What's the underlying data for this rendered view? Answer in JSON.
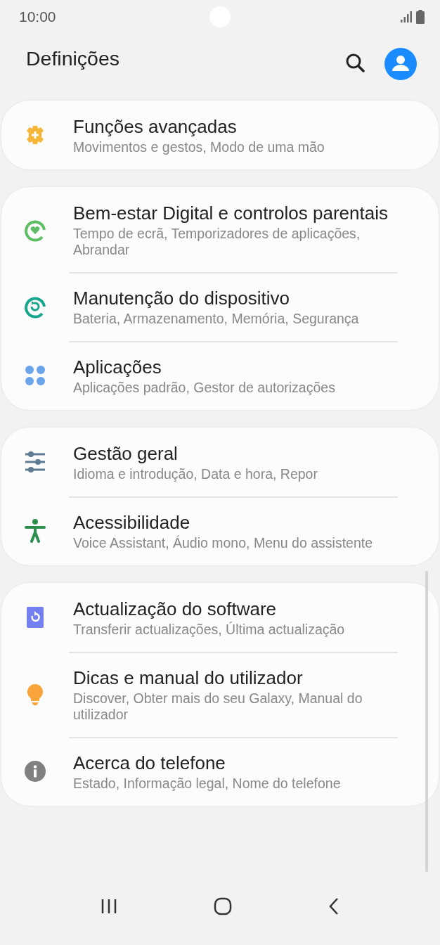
{
  "status_bar": {
    "time": "10:00"
  },
  "header": {
    "title": "Definições"
  },
  "groups": [
    {
      "items": [
        {
          "kind": "puzzle",
          "title": "Funções avançadas",
          "subtitle": "Movimentos e gestos, Modo de uma mão"
        }
      ]
    },
    {
      "items": [
        {
          "kind": "wellbeing",
          "title": "Bem-estar Digital e controlos parentais",
          "subtitle": "Tempo de ecrã, Temporizadores de aplicações, Abrandar"
        },
        {
          "kind": "care",
          "title": "Manutenção do dispositivo",
          "subtitle": "Bateria, Armazenamento, Memória, Segurança"
        },
        {
          "kind": "apps",
          "title": "Aplicações",
          "subtitle": "Aplicações padrão, Gestor de autorizações"
        }
      ]
    },
    {
      "items": [
        {
          "kind": "sliders",
          "title": "Gestão geral",
          "subtitle": "Idioma e introdução, Data e hora, Repor"
        },
        {
          "kind": "accessibility",
          "title": "Acessibilidade",
          "subtitle": "Voice Assistant, Áudio mono, Menu do assistente"
        }
      ]
    },
    {
      "items": [
        {
          "kind": "update",
          "title": "Actualização do software",
          "subtitle": "Transferir actualizações, Última actualização"
        },
        {
          "kind": "bulb",
          "title": "Dicas e manual do utilizador",
          "subtitle": "Discover, Obter mais do seu Galaxy, Manual do utilizador"
        },
        {
          "kind": "info",
          "title": "Acerca do telefone",
          "subtitle": "Estado, Informação legal, Nome do telefone"
        }
      ]
    }
  ]
}
